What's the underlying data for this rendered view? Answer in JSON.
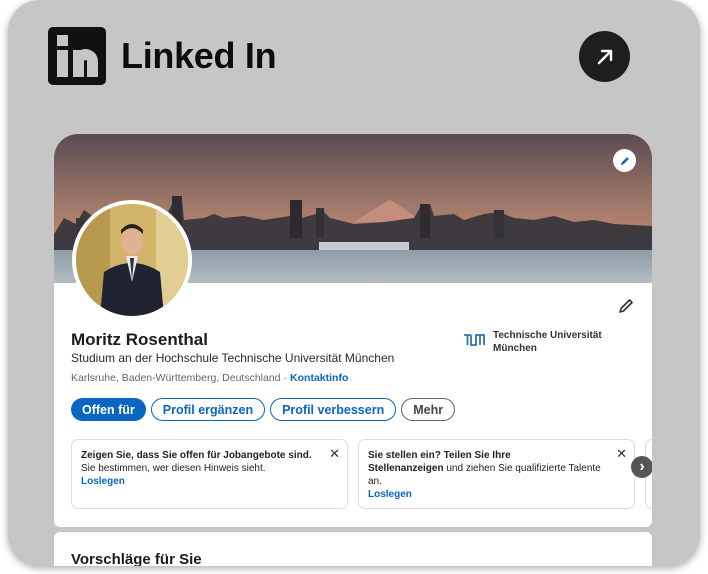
{
  "widget": {
    "brand_name": "Linked In",
    "open_icon": "arrow-up-right-icon"
  },
  "profile": {
    "name": "Moritz Rosenthal",
    "headline": "Studium an der Hochschule Technische Universität München",
    "location": "Karlsruhe, Baden-Württemberg, Deutschland",
    "location_separator": "·",
    "contact_link": "Kontaktinfo",
    "school_name": "Technische Universität München",
    "school_logo_text": "TUM"
  },
  "actions": {
    "open_to": "Offen für",
    "add_section": "Profil ergänzen",
    "enhance": "Profil verbessern",
    "more": "Mehr"
  },
  "hints": [
    {
      "bold": "Zeigen Sie, dass Sie offen für Jobangebote sind.",
      "text": " Sie bestimmen, wer diesen Hinweis sieht.",
      "link": "Loslegen"
    },
    {
      "bold_lead": "Sie stellen ein? Teilen Sie Ihre",
      "bold": "Stellenanzeigen",
      "text": " und ziehen Sie qualifizierte Talente an.",
      "link": "Loslegen"
    }
  ],
  "close_glyph": "✕",
  "next_glyph": "›",
  "suggestions": {
    "title": "Vorschläge für Sie"
  },
  "colors": {
    "accent": "#0a66c2",
    "widget_bg": "#c6c6c6",
    "logo": "#111111"
  }
}
